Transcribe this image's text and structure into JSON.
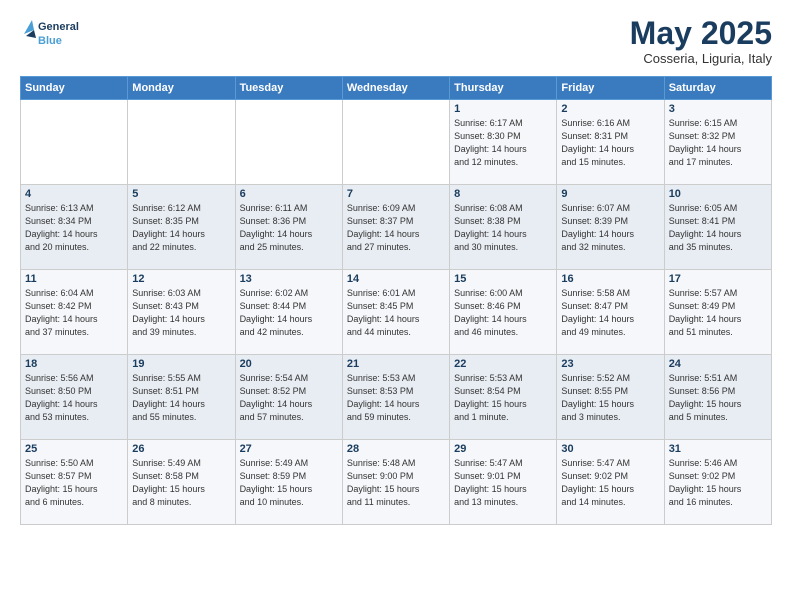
{
  "logo": {
    "line1": "General",
    "line2": "Blue"
  },
  "title": "May 2025",
  "subtitle": "Cosseria, Liguria, Italy",
  "weekdays": [
    "Sunday",
    "Monday",
    "Tuesday",
    "Wednesday",
    "Thursday",
    "Friday",
    "Saturday"
  ],
  "weeks": [
    [
      {
        "day": "",
        "info": ""
      },
      {
        "day": "",
        "info": ""
      },
      {
        "day": "",
        "info": ""
      },
      {
        "day": "",
        "info": ""
      },
      {
        "day": "1",
        "info": "Sunrise: 6:17 AM\nSunset: 8:30 PM\nDaylight: 14 hours\nand 12 minutes."
      },
      {
        "day": "2",
        "info": "Sunrise: 6:16 AM\nSunset: 8:31 PM\nDaylight: 14 hours\nand 15 minutes."
      },
      {
        "day": "3",
        "info": "Sunrise: 6:15 AM\nSunset: 8:32 PM\nDaylight: 14 hours\nand 17 minutes."
      }
    ],
    [
      {
        "day": "4",
        "info": "Sunrise: 6:13 AM\nSunset: 8:34 PM\nDaylight: 14 hours\nand 20 minutes."
      },
      {
        "day": "5",
        "info": "Sunrise: 6:12 AM\nSunset: 8:35 PM\nDaylight: 14 hours\nand 22 minutes."
      },
      {
        "day": "6",
        "info": "Sunrise: 6:11 AM\nSunset: 8:36 PM\nDaylight: 14 hours\nand 25 minutes."
      },
      {
        "day": "7",
        "info": "Sunrise: 6:09 AM\nSunset: 8:37 PM\nDaylight: 14 hours\nand 27 minutes."
      },
      {
        "day": "8",
        "info": "Sunrise: 6:08 AM\nSunset: 8:38 PM\nDaylight: 14 hours\nand 30 minutes."
      },
      {
        "day": "9",
        "info": "Sunrise: 6:07 AM\nSunset: 8:39 PM\nDaylight: 14 hours\nand 32 minutes."
      },
      {
        "day": "10",
        "info": "Sunrise: 6:05 AM\nSunset: 8:41 PM\nDaylight: 14 hours\nand 35 minutes."
      }
    ],
    [
      {
        "day": "11",
        "info": "Sunrise: 6:04 AM\nSunset: 8:42 PM\nDaylight: 14 hours\nand 37 minutes."
      },
      {
        "day": "12",
        "info": "Sunrise: 6:03 AM\nSunset: 8:43 PM\nDaylight: 14 hours\nand 39 minutes."
      },
      {
        "day": "13",
        "info": "Sunrise: 6:02 AM\nSunset: 8:44 PM\nDaylight: 14 hours\nand 42 minutes."
      },
      {
        "day": "14",
        "info": "Sunrise: 6:01 AM\nSunset: 8:45 PM\nDaylight: 14 hours\nand 44 minutes."
      },
      {
        "day": "15",
        "info": "Sunrise: 6:00 AM\nSunset: 8:46 PM\nDaylight: 14 hours\nand 46 minutes."
      },
      {
        "day": "16",
        "info": "Sunrise: 5:58 AM\nSunset: 8:47 PM\nDaylight: 14 hours\nand 49 minutes."
      },
      {
        "day": "17",
        "info": "Sunrise: 5:57 AM\nSunset: 8:49 PM\nDaylight: 14 hours\nand 51 minutes."
      }
    ],
    [
      {
        "day": "18",
        "info": "Sunrise: 5:56 AM\nSunset: 8:50 PM\nDaylight: 14 hours\nand 53 minutes."
      },
      {
        "day": "19",
        "info": "Sunrise: 5:55 AM\nSunset: 8:51 PM\nDaylight: 14 hours\nand 55 minutes."
      },
      {
        "day": "20",
        "info": "Sunrise: 5:54 AM\nSunset: 8:52 PM\nDaylight: 14 hours\nand 57 minutes."
      },
      {
        "day": "21",
        "info": "Sunrise: 5:53 AM\nSunset: 8:53 PM\nDaylight: 14 hours\nand 59 minutes."
      },
      {
        "day": "22",
        "info": "Sunrise: 5:53 AM\nSunset: 8:54 PM\nDaylight: 15 hours\nand 1 minute."
      },
      {
        "day": "23",
        "info": "Sunrise: 5:52 AM\nSunset: 8:55 PM\nDaylight: 15 hours\nand 3 minutes."
      },
      {
        "day": "24",
        "info": "Sunrise: 5:51 AM\nSunset: 8:56 PM\nDaylight: 15 hours\nand 5 minutes."
      }
    ],
    [
      {
        "day": "25",
        "info": "Sunrise: 5:50 AM\nSunset: 8:57 PM\nDaylight: 15 hours\nand 6 minutes."
      },
      {
        "day": "26",
        "info": "Sunrise: 5:49 AM\nSunset: 8:58 PM\nDaylight: 15 hours\nand 8 minutes."
      },
      {
        "day": "27",
        "info": "Sunrise: 5:49 AM\nSunset: 8:59 PM\nDaylight: 15 hours\nand 10 minutes."
      },
      {
        "day": "28",
        "info": "Sunrise: 5:48 AM\nSunset: 9:00 PM\nDaylight: 15 hours\nand 11 minutes."
      },
      {
        "day": "29",
        "info": "Sunrise: 5:47 AM\nSunset: 9:01 PM\nDaylight: 15 hours\nand 13 minutes."
      },
      {
        "day": "30",
        "info": "Sunrise: 5:47 AM\nSunset: 9:02 PM\nDaylight: 15 hours\nand 14 minutes."
      },
      {
        "day": "31",
        "info": "Sunrise: 5:46 AM\nSunset: 9:02 PM\nDaylight: 15 hours\nand 16 minutes."
      }
    ]
  ]
}
